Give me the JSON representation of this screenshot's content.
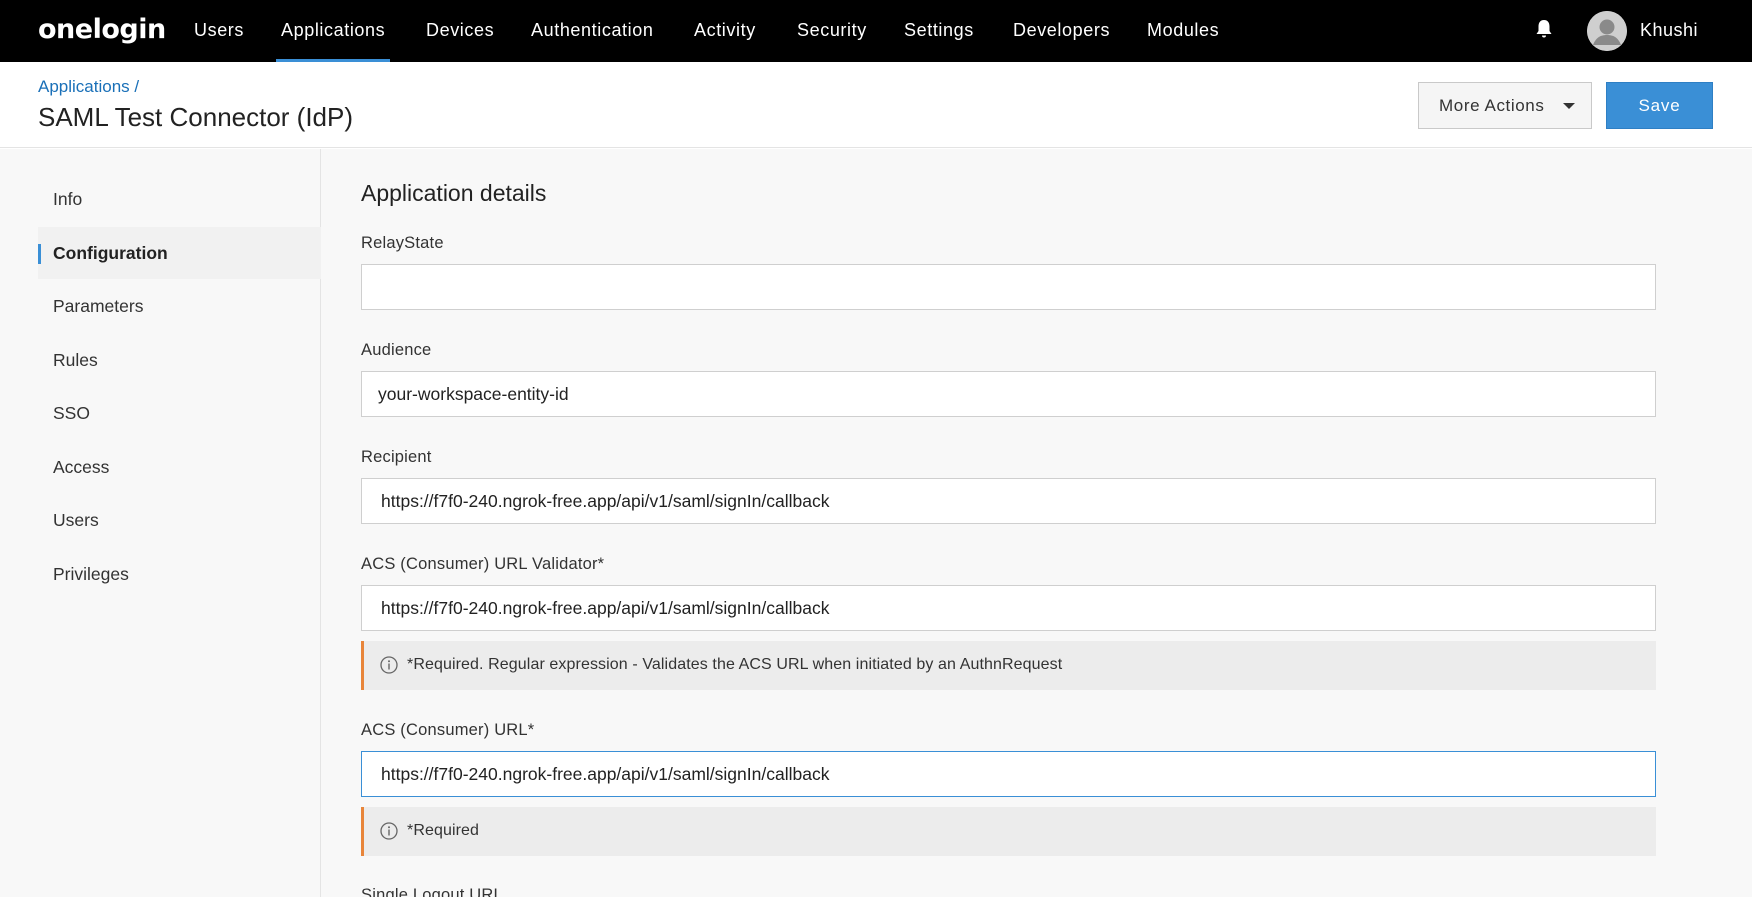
{
  "brand": {
    "logo": "onelogin"
  },
  "nav": {
    "items": [
      {
        "label": "Users"
      },
      {
        "label": "Applications"
      },
      {
        "label": "Devices"
      },
      {
        "label": "Authentication"
      },
      {
        "label": "Activity"
      },
      {
        "label": "Security"
      },
      {
        "label": "Settings"
      },
      {
        "label": "Developers"
      },
      {
        "label": "Modules"
      }
    ],
    "active": "Applications",
    "user_name": "Khushi",
    "bell_icon": "bell-icon",
    "avatar_icon": "user-avatar"
  },
  "header": {
    "breadcrumb": "Applications /",
    "title": "SAML Test Connector (IdP)",
    "more_actions": "More Actions",
    "save": "Save"
  },
  "sidebar": {
    "items": [
      {
        "label": "Info"
      },
      {
        "label": "Configuration"
      },
      {
        "label": "Parameters"
      },
      {
        "label": "Rules"
      },
      {
        "label": "SSO"
      },
      {
        "label": "Access"
      },
      {
        "label": "Users"
      },
      {
        "label": "Privileges"
      }
    ],
    "active": "Configuration"
  },
  "form": {
    "section_title": "Application details",
    "fields": [
      {
        "label": "RelayState",
        "value": ""
      },
      {
        "label": "Audience",
        "value": "your-workspace-entity-id"
      },
      {
        "label": "Recipient",
        "value": "https://f7f0-240.ngrok-free.app/api/v1/saml/signIn/callback"
      },
      {
        "label": "ACS (Consumer) URL Validator*",
        "value": "https://f7f0-240.ngrok-free.app/api/v1/saml/signIn/callback",
        "hint": "*Required. Regular expression - Validates the ACS URL when initiated by an AuthnRequest"
      },
      {
        "label": "ACS (Consumer) URL*",
        "value": "https://f7f0-240.ngrok-free.app/api/v1/saml/signIn/callback",
        "hint": "*Required"
      },
      {
        "label": "Single Logout URL"
      }
    ]
  },
  "colors": {
    "nav_bg": "#000000",
    "accent": "#3a8fd6",
    "hint_border": "#e8853a"
  }
}
